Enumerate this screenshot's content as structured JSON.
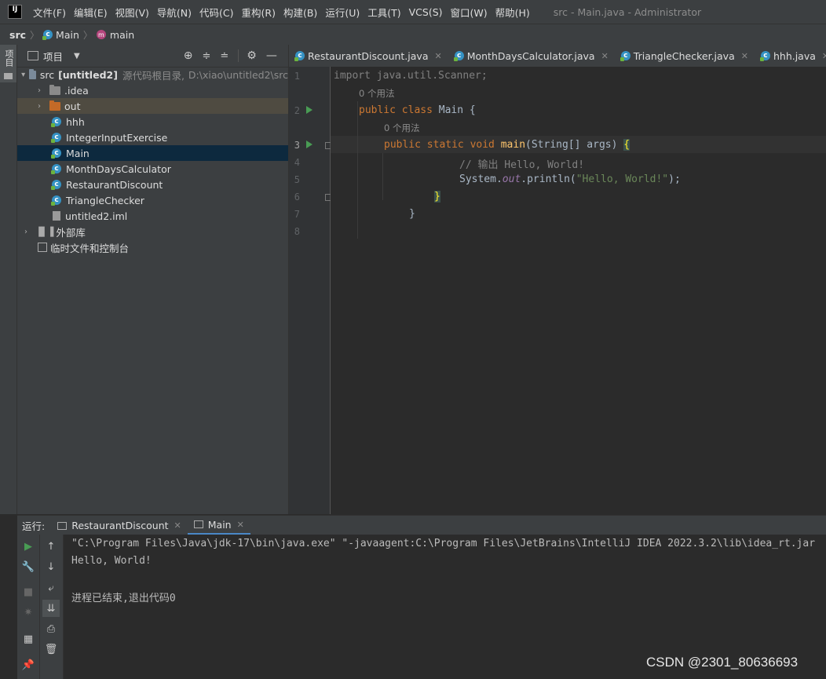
{
  "app": {
    "logo": "IJ",
    "window_title": "src - Main.java - Administrator"
  },
  "menu": [
    "文件(F)",
    "编辑(E)",
    "视图(V)",
    "导航(N)",
    "代码(C)",
    "重构(R)",
    "构建(B)",
    "运行(U)",
    "工具(T)",
    "VCS(S)",
    "窗口(W)",
    "帮助(H)"
  ],
  "breadcrumb": {
    "root": "src",
    "class": "Main",
    "method": "main",
    "class_icon": "c",
    "method_icon": "m"
  },
  "left_stripe": {
    "label": "项目"
  },
  "project": {
    "title": "项目",
    "root": {
      "name": "src",
      "module": "[untitled2]",
      "desc": "源代码根目录,",
      "path": "D:\\xiao\\untitled2\\src"
    },
    "items": [
      {
        "label": ".idea",
        "icon": "folder-icon"
      },
      {
        "label": "out",
        "icon": "folder-icon"
      },
      {
        "label": "hhh",
        "icon": "class-icon"
      },
      {
        "label": "IntegerInputExercise",
        "icon": "class-icon"
      },
      {
        "label": "Main",
        "icon": "class-icon"
      },
      {
        "label": "MonthDaysCalculator",
        "icon": "class-icon"
      },
      {
        "label": "RestaurantDiscount",
        "icon": "class-icon"
      },
      {
        "label": "TriangleChecker",
        "icon": "class-icon"
      },
      {
        "label": "untitled2.iml",
        "icon": "file-icon"
      },
      {
        "label": "外部库",
        "icon": "library-icon"
      },
      {
        "label": "临时文件和控制台",
        "icon": "scratch-icon"
      }
    ]
  },
  "tabs": [
    "RestaurantDiscount.java",
    "MonthDaysCalculator.java",
    "TriangleChecker.java",
    "hhh.java"
  ],
  "editor": {
    "line_numbers": [
      "1",
      "2",
      "3",
      "4",
      "5",
      "6",
      "7",
      "8"
    ],
    "hint_usages": "0 个用法",
    "line1": {
      "kw": "import",
      "rest": " java.util.Scanner;"
    },
    "line2": {
      "kw": "public class",
      "name": " Main ",
      "brace": "{"
    },
    "line3": {
      "kw": "public static void",
      "fn": " main",
      "args": "(String[] args) ",
      "brace": "{"
    },
    "line4": "// 输出 Hello, World!",
    "line5": {
      "pre": "System.",
      "out": "out",
      "mid": ".println(",
      "str": "\"Hello, World!\"",
      "end": ");"
    },
    "line6": "}",
    "line7": "}"
  },
  "run": {
    "label": "运行:",
    "tabs": [
      "RestaurantDiscount",
      "Main"
    ],
    "console": [
      "\"C:\\Program Files\\Java\\jdk-17\\bin\\java.exe\" \"-javaagent:C:\\Program Files\\JetBrains\\IntelliJ IDEA 2022.3.2\\lib\\idea_rt.jar",
      "Hello, World!",
      "",
      "进程已结束,退出代码0"
    ]
  },
  "watermark": "CSDN @2301_80636693",
  "colors": {
    "accent": "#4a88c7",
    "run_green": "#499c54",
    "keyword": "#cc7832",
    "string": "#6a8759"
  }
}
